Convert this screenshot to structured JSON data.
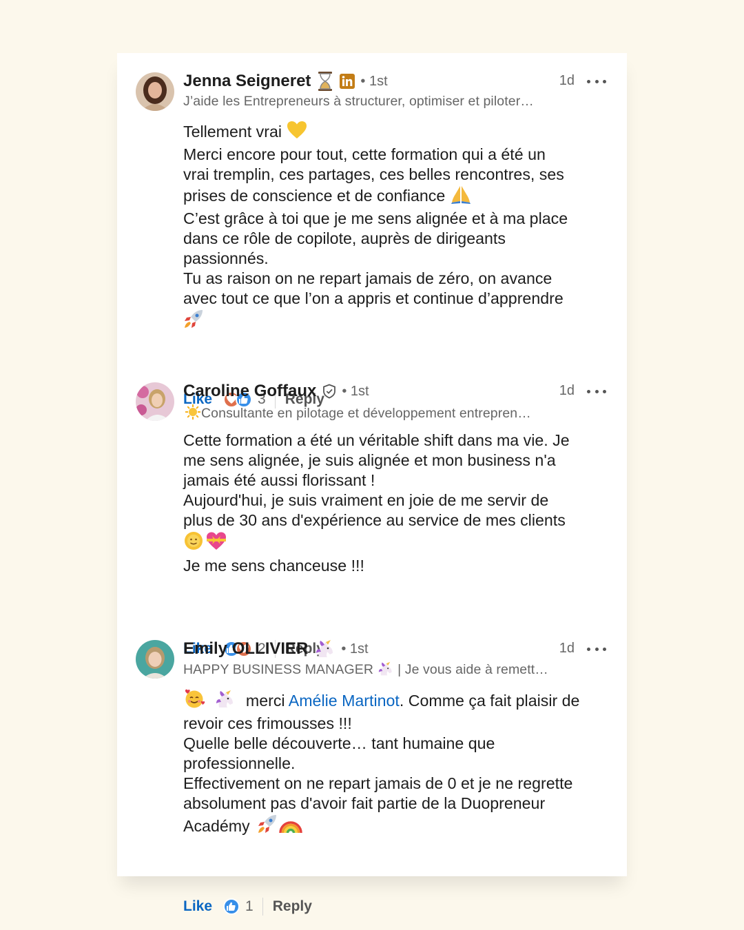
{
  "comments": [
    {
      "name": "Jenna Seigneret",
      "name_icons": [
        "hourglass-icon",
        "linkedin-badge-icon"
      ],
      "degree": "• 1st",
      "time": "1d",
      "headline": "J’aide les Entrepreneurs à structurer, optimiser et piloter…",
      "body": [
        "Tellement vrai",
        "Merci encore pour tout, cette formation qui a été un",
        "vrai tremplin, ces partages, ces belles rencontres, ses",
        "prises de conscience et de confiance",
        "C’est grâce à toi que je me sens alignée et à ma place",
        "dans ce rôle de copilote, auprès de dirigeants",
        "passionnés.",
        "Tu as raison on ne repart jamais de zéro, on avance",
        "avec tout ce que l’on a appris et continue d’apprendre"
      ],
      "like_label": "Like",
      "reaction_count": "3",
      "reply_label": "Reply"
    },
    {
      "name": "Caroline Goffaux",
      "name_icons": [
        "verified-shield-icon"
      ],
      "degree": "• 1st",
      "time": "1d",
      "headline": "Consultante en pilotage et développement entrepren…",
      "body": [
        "Cette formation a été un véritable shift dans ma vie. Je",
        "me sens alignée, je suis alignée et mon business n'a",
        "jamais été aussi florissant !",
        "Aujourd'hui, je suis vraiment en joie de me servir de",
        "plus de 30 ans d'expérience au service de mes clients",
        "Je me sens chanceuse !!!"
      ],
      "like_label": "Like",
      "reaction_count": "2",
      "reply_label": "Reply"
    },
    {
      "name": "Emily OLLIVIER",
      "name_icons": [
        "unicorn-icon"
      ],
      "degree": "• 1st",
      "time": "1d",
      "headline_a": "HAPPY BUSINESS MANAGER",
      "headline_b": "| Je vous aide à remett…",
      "body_mention_pre": "merci",
      "mention": "Amélie Martinot",
      "body_mention_post": ". Comme ça fait plaisir de",
      "body": [
        "revoir ces frimousses !!!",
        "Quelle belle découverte… tant humaine que",
        "professionnelle.",
        "Effectivement on ne repart jamais de 0 et je ne regrette",
        "absolument pas d'avoir fait partie de la Duopreneur",
        "Académy"
      ],
      "like_label": "Like",
      "reaction_count": "1",
      "reply_label": "Reply"
    }
  ],
  "colors": {
    "background": "#fcf8ec",
    "card": "#ffffff",
    "link": "#0a66c2",
    "muted": "#666666"
  }
}
